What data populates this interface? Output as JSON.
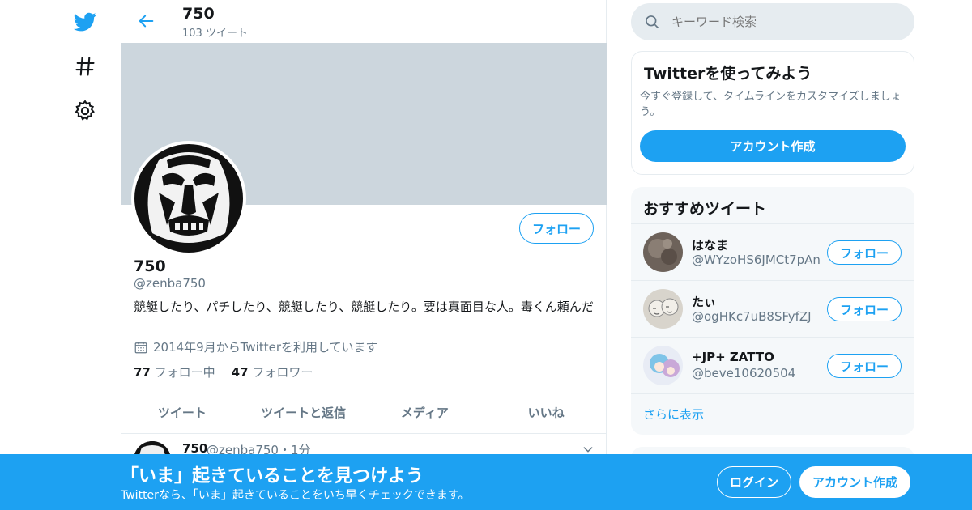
{
  "colors": {
    "accent": "#1da1f2",
    "banner": "#ccd6dd",
    "secondary_text": "#657786"
  },
  "nav": {
    "icons": [
      "twitter-logo-icon",
      "hashtag-icon",
      "gear-icon"
    ]
  },
  "header": {
    "name": "750",
    "tweet_count": "103 ツイート"
  },
  "profile": {
    "follow_label": "フォロー",
    "name": "750",
    "handle": "@zenba750",
    "bio": "競艇したり、パチしたり、競艇したり、競艇したり。要は真面目な人。毒くん頼んだ",
    "joined": "2014年9月からTwitterを利用しています",
    "following_count": "77",
    "following_label": "フォロー中",
    "followers_count": "47",
    "followers_label": "フォロワー"
  },
  "tabs": [
    "ツイート",
    "ツイートと返信",
    "メディア",
    "いいね"
  ],
  "tweet": {
    "name": "750",
    "handle_time": "@zenba750・1分"
  },
  "search": {
    "placeholder": "キーワード検索"
  },
  "signup_card": {
    "title": "Twitterを使ってみよう",
    "text": "今すぐ登録して、タイムラインをカスタマイズしましょう。",
    "button": "アカウント作成"
  },
  "suggestions": {
    "title": "おすすめツイート",
    "items": [
      {
        "name": "はなま",
        "handle": "@WYzoHS6JMCt7pAn",
        "follow": "フォロー"
      },
      {
        "name": "たぃ",
        "handle": "@ogHKc7uB8SFyfZJ",
        "follow": "フォロー"
      },
      {
        "name": "+JP+ ZATTO",
        "handle": "@beve10620504",
        "follow": "フォロー"
      }
    ],
    "show_more": "さらに表示"
  },
  "bottom_bar": {
    "title": "「いま」起きていることを見つけよう",
    "subtitle": "Twitterなら、「いま」起きていることをいち早くチェックできます。",
    "login": "ログイン",
    "signup": "アカウント作成"
  }
}
